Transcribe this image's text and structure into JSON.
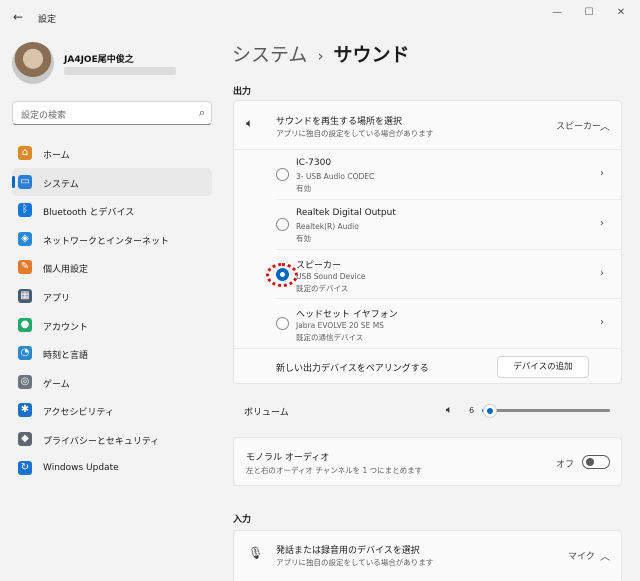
{
  "window": {
    "title": "設定"
  },
  "profile": {
    "name": "JA4JOE尾中俊之"
  },
  "search": {
    "placeholder": "設定の検索"
  },
  "nav": [
    {
      "label": "ホーム",
      "icon": "home-icon",
      "color": "#d98a2b",
      "glyph": "⌂"
    },
    {
      "label": "システム",
      "icon": "monitor-icon",
      "color": "#2d7ed6",
      "glyph": "▭",
      "active": true
    },
    {
      "label": "Bluetooth とデバイス",
      "icon": "bluetooth-icon",
      "color": "#1677d8",
      "glyph": "ᛒ"
    },
    {
      "label": "ネットワークとインターネット",
      "icon": "wifi-icon",
      "color": "#2b87d8",
      "glyph": "◈"
    },
    {
      "label": "個人用設定",
      "icon": "brush-icon",
      "color": "#e07b2c",
      "glyph": "✎"
    },
    {
      "label": "アプリ",
      "icon": "apps-icon",
      "color": "#4a5b74",
      "glyph": "▦"
    },
    {
      "label": "アカウント",
      "icon": "person-icon",
      "color": "#23a86b",
      "glyph": "●"
    },
    {
      "label": "時刻と言語",
      "icon": "globe-clock-icon",
      "color": "#2d89cf",
      "glyph": "◔"
    },
    {
      "label": "ゲーム",
      "icon": "gamepad-icon",
      "color": "#6c7480",
      "glyph": "◎"
    },
    {
      "label": "アクセシビリティ",
      "icon": "accessibility-icon",
      "color": "#1b6fc7",
      "glyph": "✱"
    },
    {
      "label": "プライバシーとセキュリティ",
      "icon": "shield-icon",
      "color": "#5f6773",
      "glyph": "◆"
    },
    {
      "label": "Windows Update",
      "icon": "update-icon",
      "color": "#1773d4",
      "glyph": "↻"
    }
  ],
  "breadcrumb": {
    "parent": "システム",
    "separator": "›",
    "current": "サウンド"
  },
  "output": {
    "heading": "出力",
    "selector": {
      "title": "サウンドを再生する場所を選択",
      "subtitle": "アプリに独自の設定をしている場合があります",
      "value": "スピーカー"
    },
    "devices": [
      {
        "name": "IC-7300",
        "detail": "3- USB Audio CODEC",
        "status": "有効",
        "selected": false
      },
      {
        "name": "Realtek Digital Output",
        "detail": "Realtek(R) Audio",
        "status": "有効",
        "selected": false
      },
      {
        "name": "スピーカー",
        "detail": "USB Sound Device",
        "status": "既定のデバイス",
        "selected": true
      },
      {
        "name": "ヘッドセット イヤフォン",
        "detail": "Jabra EVOLVE 20 SE MS",
        "status": "既定の通信デバイス",
        "selected": false
      }
    ],
    "pair": {
      "label": "新しい出力デバイスをペアリングする",
      "button": "デバイスの追加"
    },
    "volume": {
      "label": "ボリューム",
      "value": "6",
      "fraction": 0.06
    },
    "mono": {
      "title": "モノラル オーディオ",
      "subtitle": "左と右のオーディオ チャンネルを 1 つにまとめます",
      "state": "オフ"
    }
  },
  "input": {
    "heading": "入力",
    "selector": {
      "title": "発話または録音用のデバイスを選択",
      "subtitle": "アプリに独自の設定をしている場合があります",
      "value": "マイク"
    }
  }
}
